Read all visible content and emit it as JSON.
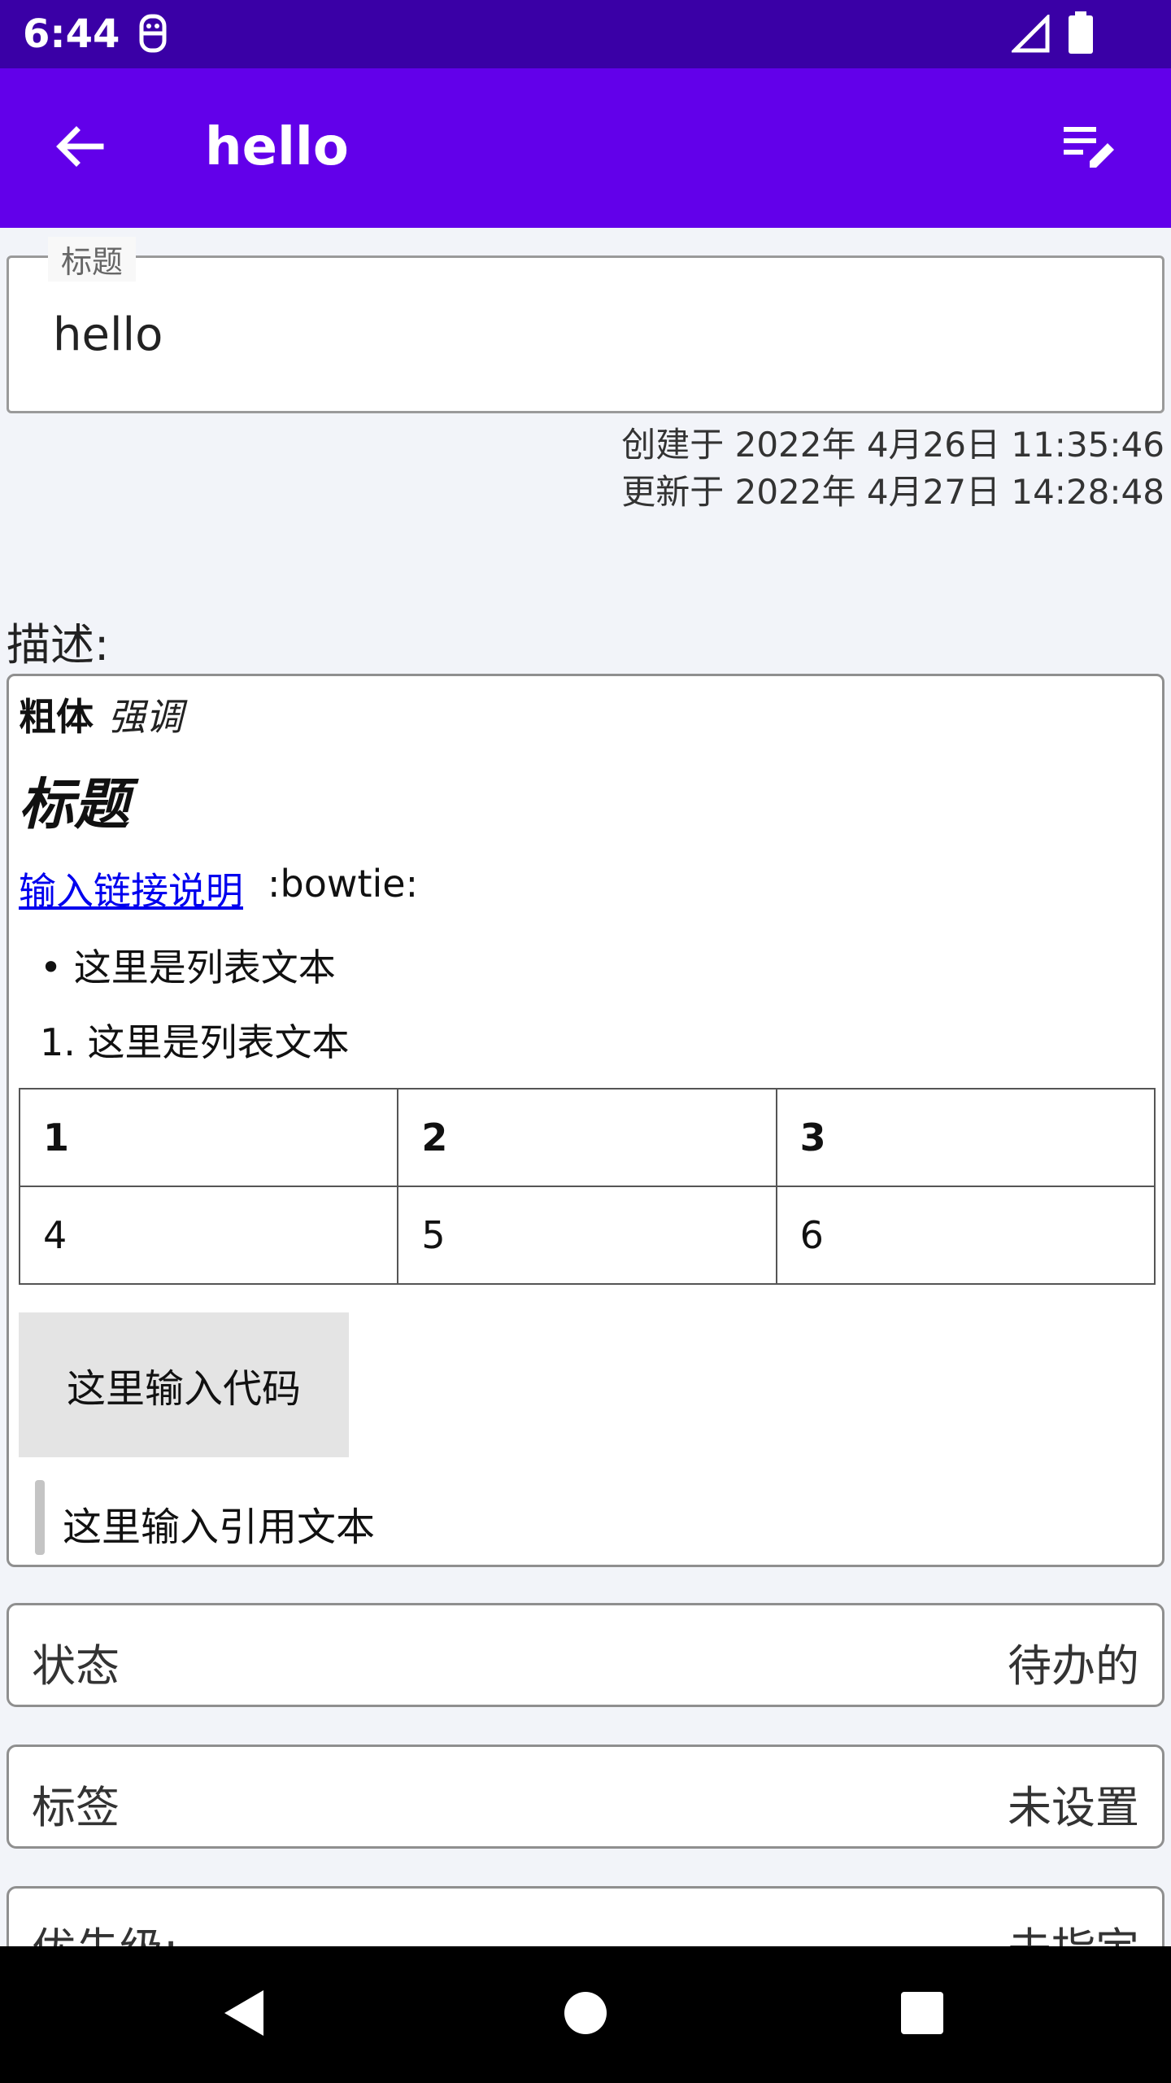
{
  "status_bar": {
    "time": "6:44"
  },
  "app_bar": {
    "title": "hello"
  },
  "title_field": {
    "label": "标题",
    "value": "hello"
  },
  "timestamps": {
    "created": "创建于 2022年 4月26日 11:35:46",
    "updated": "更新于 2022年 4月27日 14:28:48"
  },
  "description": {
    "label": "描述:",
    "bold_text": "粗体",
    "emphasis_text": "强调",
    "heading": "标题",
    "link_text": "输入链接说明",
    "emoji_code": ":bowtie:",
    "bullet_item": "• 这里是列表文本",
    "ordered_item": "1. 这里是列表文本",
    "table": {
      "headers": [
        "1",
        "2",
        "3"
      ],
      "rows": [
        [
          "4",
          "5",
          "6"
        ]
      ]
    },
    "code": "这里输入代码",
    "quote": "这里输入引用文本"
  },
  "rows": {
    "status": {
      "label": "状态",
      "value": "待办的"
    },
    "tags": {
      "label": "标签",
      "value": "未设置"
    },
    "priority": {
      "label": "优先级:",
      "value": "未指定"
    }
  },
  "colors": {
    "status_bar": "#3a00a6",
    "app_bar": "#6200ea",
    "link": "#0000ee"
  },
  "icons": {
    "back": "arrow-back-icon",
    "edit": "edit-notes-icon",
    "signal": "signal-icon",
    "battery": "battery-icon",
    "notification": "notification-icon",
    "nav_back": "nav-back-icon",
    "nav_home": "nav-home-icon",
    "nav_recents": "nav-recents-icon"
  }
}
